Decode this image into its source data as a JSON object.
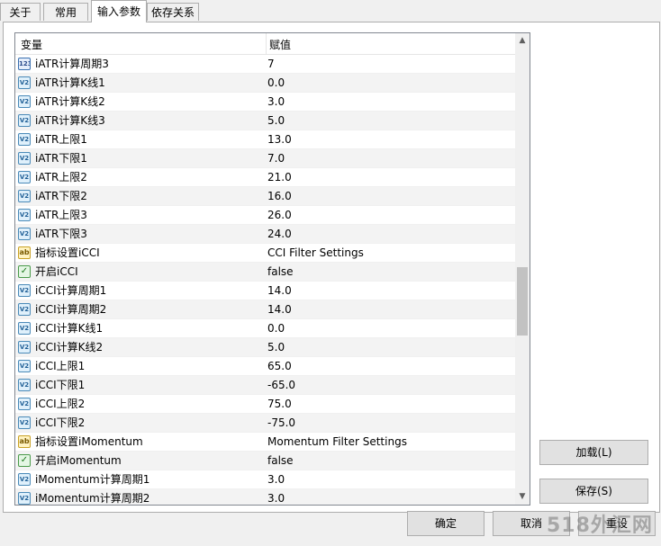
{
  "tabs": [
    {
      "label": "关于"
    },
    {
      "label": "常用"
    },
    {
      "label": "输入参数",
      "active": true
    },
    {
      "label": "依存关系"
    }
  ],
  "grid": {
    "col_variable": "变量",
    "col_value": "赋值",
    "rows": [
      {
        "icon": "123",
        "type": "int",
        "name": "iATR计算周期3",
        "value": "7"
      },
      {
        "icon": "V2",
        "type": "double",
        "name": "iATR计算K线1",
        "value": "0.0"
      },
      {
        "icon": "V2",
        "type": "double",
        "name": "iATR计算K线2",
        "value": "3.0"
      },
      {
        "icon": "V2",
        "type": "double",
        "name": "iATR计算K线3",
        "value": "5.0"
      },
      {
        "icon": "V2",
        "type": "double",
        "name": "iATR上限1",
        "value": "13.0"
      },
      {
        "icon": "V2",
        "type": "double",
        "name": "iATR下限1",
        "value": "7.0"
      },
      {
        "icon": "V2",
        "type": "double",
        "name": "iATR上限2",
        "value": "21.0"
      },
      {
        "icon": "V2",
        "type": "double",
        "name": "iATR下限2",
        "value": "16.0"
      },
      {
        "icon": "V2",
        "type": "double",
        "name": "iATR上限3",
        "value": "26.0"
      },
      {
        "icon": "V2",
        "type": "double",
        "name": "iATR下限3",
        "value": "24.0"
      },
      {
        "icon": "ab",
        "type": "string",
        "name": "指标设置iCCI",
        "value": "CCI Filter Settings"
      },
      {
        "icon": "✓",
        "type": "bool",
        "name": "开启iCCI",
        "value": "false"
      },
      {
        "icon": "V2",
        "type": "double",
        "name": "iCCI计算周期1",
        "value": "14.0"
      },
      {
        "icon": "V2",
        "type": "double",
        "name": "iCCI计算周期2",
        "value": "14.0"
      },
      {
        "icon": "V2",
        "type": "double",
        "name": "iCCI计算K线1",
        "value": "0.0"
      },
      {
        "icon": "V2",
        "type": "double",
        "name": "iCCI计算K线2",
        "value": "5.0"
      },
      {
        "icon": "V2",
        "type": "double",
        "name": "iCCI上限1",
        "value": "65.0"
      },
      {
        "icon": "V2",
        "type": "double",
        "name": "iCCI下限1",
        "value": "-65.0"
      },
      {
        "icon": "V2",
        "type": "double",
        "name": "iCCI上限2",
        "value": "75.0"
      },
      {
        "icon": "V2",
        "type": "double",
        "name": "iCCI下限2",
        "value": "-75.0"
      },
      {
        "icon": "ab",
        "type": "string",
        "name": "指标设置iMomentum",
        "value": "Momentum Filter Settings"
      },
      {
        "icon": "✓",
        "type": "bool",
        "name": "开启iMomentum",
        "value": "false"
      },
      {
        "icon": "V2",
        "type": "double",
        "name": "iMomentum计算周期1",
        "value": "3.0"
      },
      {
        "icon": "V2",
        "type": "double",
        "name": "iMomentum计算周期2",
        "value": "3.0"
      }
    ]
  },
  "buttons": {
    "load": "加载(L)",
    "save": "保存(S)",
    "ok": "确定",
    "cancel": "取消",
    "reset": "重设"
  },
  "watermark": "518外汇网",
  "icons": {
    "scroll_up": "up-arrow-icon",
    "scroll_down": "down-arrow-icon",
    "int": "integer-icon",
    "double": "double-icon",
    "string": "string-icon",
    "bool": "boolean-icon"
  }
}
